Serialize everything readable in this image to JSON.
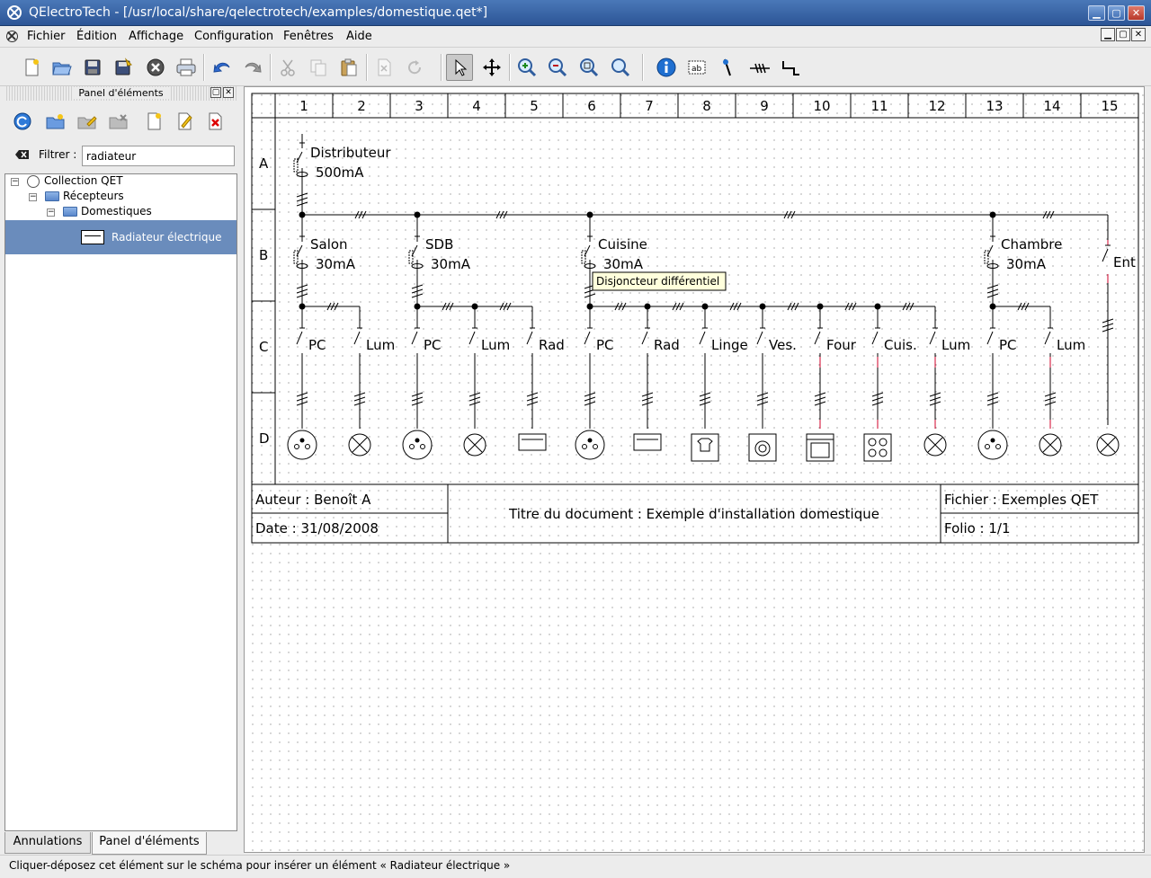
{
  "window": {
    "title": "QElectroTech - [/usr/local/share/qelectrotech/examples/domestique.qet*]",
    "controls": [
      "▁",
      "▢",
      "✕"
    ]
  },
  "menu": {
    "items": [
      "Fichier",
      "Édition",
      "Affichage",
      "Configuration",
      "Fenêtres",
      "Aide"
    ],
    "mdi_controls": [
      "▁",
      "▢",
      "✕"
    ]
  },
  "toolbar": {
    "buttons": [
      "new-file",
      "open-file",
      "save",
      "save-as",
      "close",
      "print",
      "undo",
      "redo",
      "cut",
      "copy",
      "paste",
      "delete",
      "rotate",
      "select-mode",
      "move-mode",
      "zoom-in",
      "zoom-out",
      "zoom-fit",
      "zoom-reset",
      "properties",
      "add-text",
      "add-column",
      "add-conductor",
      "reset-conductors"
    ]
  },
  "panel": {
    "title": "Panel d'éléments",
    "filter_label": "Filtrer :",
    "filter_value": "radiateur",
    "tree": {
      "root": "Collection QET",
      "level1": "Récepteurs",
      "level2": "Domestiques",
      "leaf": "Radiateur électrique"
    },
    "tabs": [
      "Annulations",
      "Panel d'éléments"
    ]
  },
  "diagram": {
    "columns": [
      "1",
      "2",
      "3",
      "4",
      "5",
      "6",
      "7",
      "8",
      "9",
      "10",
      "11",
      "12",
      "13",
      "14",
      "15"
    ],
    "rows": [
      "A",
      "B",
      "C",
      "D"
    ],
    "main_breaker": {
      "name": "Distributeur",
      "rating": "500mA"
    },
    "breakers": [
      {
        "name": "Salon",
        "rating": "30mA"
      },
      {
        "name": "SDB",
        "rating": "30mA"
      },
      {
        "name": "Cuisine",
        "rating": "30mA"
      },
      {
        "name": "Chambre",
        "rating": "30mA"
      },
      {
        "name": "Ent"
      }
    ],
    "circuit_labels": [
      "PC",
      "Lum",
      "PC",
      "Lum",
      "Rad",
      "PC",
      "Rad",
      "Linge",
      "Ves.",
      "Four",
      "Cuis.",
      "Lum",
      "PC",
      "Lum"
    ],
    "tooltip": "Disjoncteur différentiel",
    "titleblock": {
      "author": "Auteur : Benoît A",
      "date": "Date : 31/08/2008",
      "doc_title": "Titre du document : Exemple d'installation domestique",
      "file": "Fichier : Exemples QET",
      "folio": "Folio : 1/1"
    }
  },
  "status": {
    "text": "Cliquer-déposez cet élément sur le schéma pour insérer un élément « Radiateur électrique »"
  },
  "colors": {
    "titlebar": "#3a66a8",
    "selection": "#6a8cbc",
    "wire": "#000000",
    "wire_red": "#d0002a"
  }
}
